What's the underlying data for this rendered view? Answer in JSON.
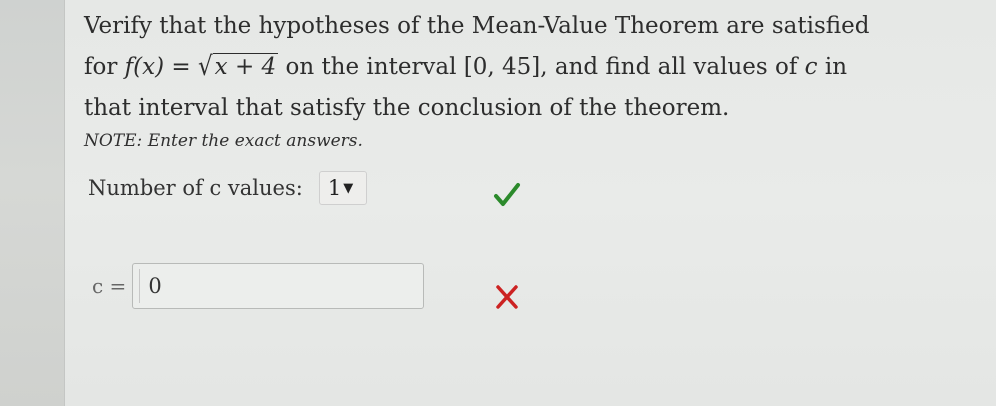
{
  "question": {
    "line1": "Verify that the hypotheses of the Mean-Value Theorem are satisfied",
    "line2_prefix": "for ",
    "func_lhs": "f(x) = ",
    "sqrt_symbol": "√",
    "radicand": "x + 4",
    "line2_mid": " on the interval [0, 45], and find all values of ",
    "var_c": "c",
    "line2_suffix": " in",
    "line3": "that interval that satisfy the conclusion of the theorem."
  },
  "note": "NOTE: Enter the exact answers.",
  "count_field": {
    "label": "Number of c values:",
    "selected_value": "1",
    "dropdown_arrow": "▼",
    "status_icon": "checkmark-icon",
    "status_color": "#2b8a2b"
  },
  "c_field": {
    "label": "c =",
    "value": "0",
    "status_icon": "cross-icon",
    "status_color": "#cc2222"
  }
}
